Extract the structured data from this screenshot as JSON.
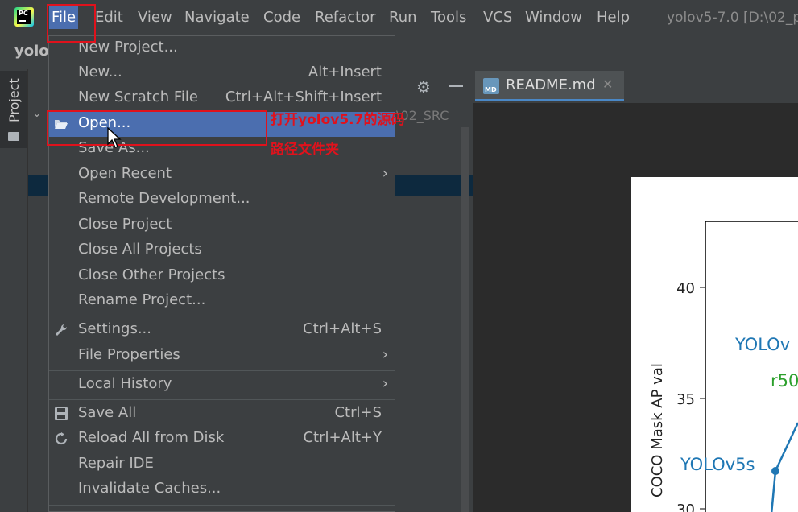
{
  "menubar": {
    "items": [
      {
        "label": "File",
        "mnemonic": "F",
        "rest": "ile"
      },
      {
        "label": "Edit",
        "mnemonic": "E",
        "rest": "dit"
      },
      {
        "label": "View",
        "mnemonic": "V",
        "rest": "iew"
      },
      {
        "label": "Navigate",
        "mnemonic": "N",
        "rest": "avigate"
      },
      {
        "label": "Code",
        "mnemonic": "C",
        "rest": "ode"
      },
      {
        "label": "Refactor",
        "mnemonic": "R",
        "rest": "efactor"
      },
      {
        "label": "Run",
        "mnemonic": "",
        "rest": "Run"
      },
      {
        "label": "Tools",
        "mnemonic": "T",
        "rest": "ools"
      },
      {
        "label": "VCS",
        "mnemonic": "",
        "rest": "VCS"
      },
      {
        "label": "Window",
        "mnemonic": "W",
        "rest": "indow"
      },
      {
        "label": "Help",
        "mnemonic": "H",
        "rest": "elp"
      }
    ],
    "window_title": "yolov5-7.0 [D:\\02_p"
  },
  "project_bar": {
    "name": "yolo"
  },
  "side_strip": {
    "project_tab": "Project"
  },
  "project_panel": {
    "path_fragment": "\\02_SRC"
  },
  "editor": {
    "tab_label": "README.md",
    "tab_icon_text": "MD"
  },
  "file_menu": {
    "items": [
      {
        "label": "New Project...",
        "shortcut": ""
      },
      {
        "label": "New...",
        "shortcut": "Alt+Insert"
      },
      {
        "label": "New Scratch File",
        "shortcut": "Ctrl+Alt+Shift+Insert"
      },
      {
        "label": "Open...",
        "shortcut": ""
      },
      {
        "label": "Save As...",
        "shortcut": ""
      },
      {
        "label": "Open Recent",
        "shortcut": ""
      },
      {
        "label": "Remote Development...",
        "shortcut": ""
      },
      {
        "label": "Close Project",
        "shortcut": ""
      },
      {
        "label": "Close All Projects",
        "shortcut": ""
      },
      {
        "label": "Close Other Projects",
        "shortcut": ""
      },
      {
        "label": "Rename Project...",
        "shortcut": ""
      },
      {
        "label": "Settings...",
        "shortcut": "Ctrl+Alt+S"
      },
      {
        "label": "File Properties",
        "shortcut": ""
      },
      {
        "label": "Local History",
        "shortcut": ""
      },
      {
        "label": "Save All",
        "shortcut": "Ctrl+S"
      },
      {
        "label": "Reload All from Disk",
        "shortcut": "Ctrl+Alt+Y"
      },
      {
        "label": "Repair IDE",
        "shortcut": ""
      },
      {
        "label": "Invalidate Caches...",
        "shortcut": ""
      }
    ]
  },
  "annotation": {
    "line1": "打开yolov5.7的源码",
    "line2": "路径文件夹"
  },
  "chart_data": {
    "type": "line",
    "ylabel": "COCO Mask AP val",
    "yticks": [
      "40",
      "35",
      "30"
    ],
    "labels": [
      {
        "text": "YOLOv",
        "color": "#1f77b4"
      },
      {
        "text": "r50",
        "color": "#2ca02c"
      },
      {
        "text": "YOLOv5s",
        "color": "#1f77b4"
      }
    ],
    "series_color": "#1f77b4"
  },
  "colors": {
    "accent": "#4b6eaf",
    "highlight": "#e0121c",
    "menu_bg": "#3c3f41"
  }
}
